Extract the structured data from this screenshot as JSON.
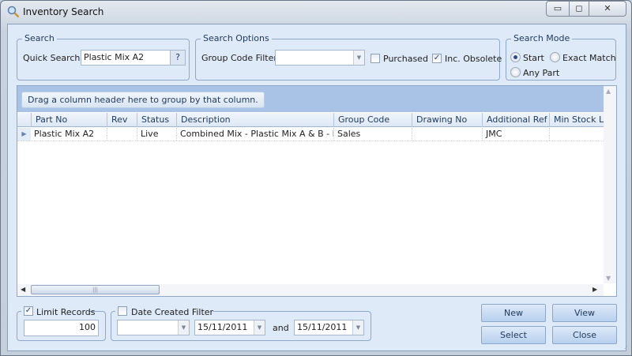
{
  "window": {
    "title": "Inventory Search",
    "controls": {
      "minimize": "▭",
      "maximize": "◻",
      "close": "✕"
    }
  },
  "search": {
    "group_title": "Search",
    "quick_search_label": "Quick Search",
    "quick_search_value": "Plastic Mix A2",
    "help_label": "?"
  },
  "search_options": {
    "group_title": "Search Options",
    "group_code_label": "Group Code Filter",
    "group_code_value": "",
    "purchased_label": "Purchased",
    "purchased_checked": false,
    "inc_obsolete_label": "Inc. Obsolete",
    "inc_obsolete_checked": true
  },
  "search_mode": {
    "group_title": "Search Mode",
    "options": [
      "Start",
      "Exact Match",
      "Any Part"
    ],
    "selected": "Start"
  },
  "grid": {
    "group_hint": "Drag a column header here to group by that column.",
    "columns": [
      "Part No",
      "Rev",
      "Status",
      "Description",
      "Group Code",
      "Drawing No",
      "Additional Ref",
      "Min Stock Le"
    ],
    "rows": [
      [
        "Plastic Mix A2",
        "",
        "Live",
        "Combined Mix - Plastic Mix A & B - No ...",
        "Sales",
        "",
        "JMC",
        ""
      ]
    ]
  },
  "limit": {
    "label": "Limit Records",
    "checked": true,
    "value": "100"
  },
  "date_filter": {
    "label": "Date Created Filter",
    "checked": false,
    "mode_value": "",
    "from": "15/11/2011",
    "and_label": "and",
    "to": "15/11/2011"
  },
  "buttons": {
    "new": "New",
    "view": "View",
    "select": "Select",
    "close": "Close"
  }
}
